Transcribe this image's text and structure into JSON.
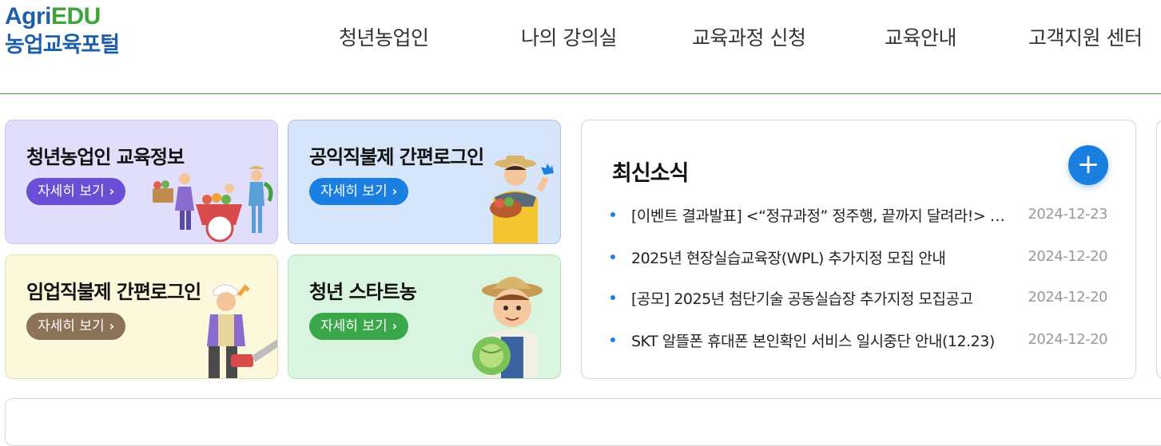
{
  "logo": {
    "brand_agri": "Agri",
    "brand_edu": "EDU",
    "subtitle": "농업교육포털"
  },
  "nav": [
    {
      "label": "청년농업인"
    },
    {
      "label": "나의 강의실"
    },
    {
      "label": "교육과정 신청"
    },
    {
      "label": "교육안내"
    },
    {
      "label": "고객지원 센터"
    }
  ],
  "cards": [
    {
      "title": "청년농업인 교육정보",
      "button": "자세히 보기",
      "bg": "#e0defa",
      "btn_color": "#6a4fd6"
    },
    {
      "title": "공익직불제 간편로그인",
      "button": "자세히 보기",
      "bg": "#d7e5fb",
      "btn_color": "#1a7fe0"
    },
    {
      "title": "임업직불제 간편로그인",
      "button": "자세히 보기",
      "bg": "#fcf8dc",
      "btn_color": "#8c7257"
    },
    {
      "title": "청년 스타트농",
      "button": "자세히 보기",
      "bg": "#daf5df",
      "btn_color": "#3aa84a"
    }
  ],
  "news": {
    "title": "최신소식",
    "more_icon": "plus-icon",
    "items": [
      {
        "text": "[이벤트 결과발표] <“정규과정” 정주행, 끝까지 달려라!> 이벤트 당첨자 발표",
        "date": "2024-12-23"
      },
      {
        "text": "2025년 현장실습교육장(WPL) 추가지정 모집 안내",
        "date": "2024-12-20"
      },
      {
        "text": "[공모] 2025년 첨단기술 공동실습장 추가지정 모집공고",
        "date": "2024-12-20"
      },
      {
        "text": "SKT 알뜰폰 휴대폰 본인확인 서비스 일시중단 안내(12.23)",
        "date": "2024-12-20"
      }
    ]
  },
  "colors": {
    "brand_blue": "#1f5fa8",
    "brand_green": "#3da33a",
    "accent_blue": "#1a7fe0"
  }
}
